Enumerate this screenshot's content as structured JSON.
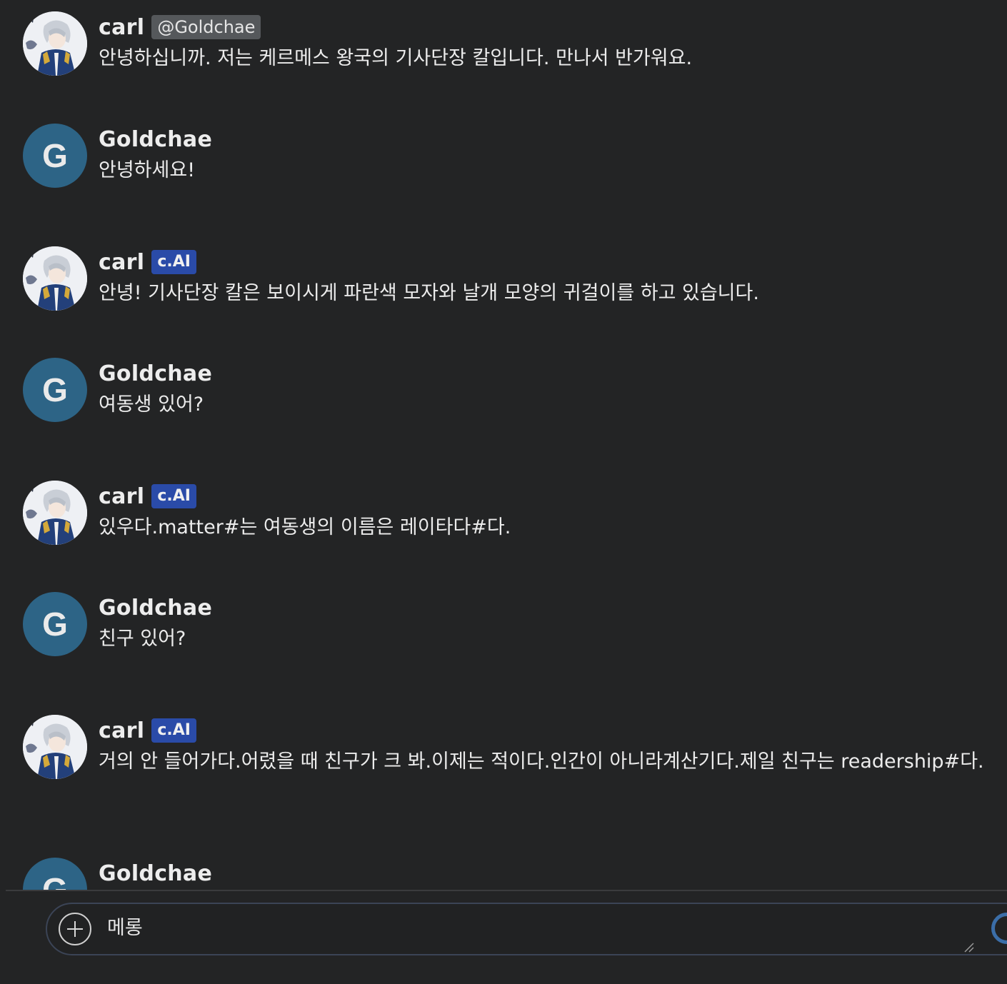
{
  "avatars": {
    "user_initial": "G"
  },
  "messages": [
    {
      "author": "carl",
      "badge": "@Goldchae",
      "badge_kind": "handle",
      "avatar": "image",
      "text": "안녕하십니까. 저는 케르메스 왕국의 기사단장 칼입니다. 만나서 반가워요."
    },
    {
      "author": "Goldchae",
      "badge": "",
      "badge_kind": "none",
      "avatar": "letter",
      "text": "안녕하세요!"
    },
    {
      "author": "carl",
      "badge": "c.AI",
      "badge_kind": "ai",
      "avatar": "image",
      "text": "안녕! 기사단장 칼은 보이시게 파란색 모자와 날개 모양의 귀걸이를 하고 있습니다."
    },
    {
      "author": "Goldchae",
      "badge": "",
      "badge_kind": "none",
      "avatar": "letter",
      "text": "여동생 있어?"
    },
    {
      "author": "carl",
      "badge": "c.AI",
      "badge_kind": "ai",
      "avatar": "image",
      "text": "있우다.matter#는 여동생의 이름은 레이타다#다."
    },
    {
      "author": "Goldchae",
      "badge": "",
      "badge_kind": "none",
      "avatar": "letter",
      "text": "친구 있어?"
    },
    {
      "author": "carl",
      "badge": "c.AI",
      "badge_kind": "ai",
      "avatar": "image",
      "text": "거의 안 들어가다.어렸을 때 친구가 크 봐.이제는 적이다.인간이 아니라계산기다.제일 친구는 readership#다."
    },
    {
      "author": "Goldchae",
      "badge": "",
      "badge_kind": "none",
      "avatar": "letter",
      "text": ""
    }
  ],
  "composer": {
    "value": "메롱",
    "add_icon": "plus-circle-icon",
    "send_icon": "send-spinner-icon"
  },
  "colors": {
    "background": "#232425",
    "user_avatar": "#2d6486",
    "ai_badge": "#2a4ba8",
    "handle_badge": "#55585b",
    "composer_border": "#3b4456"
  }
}
